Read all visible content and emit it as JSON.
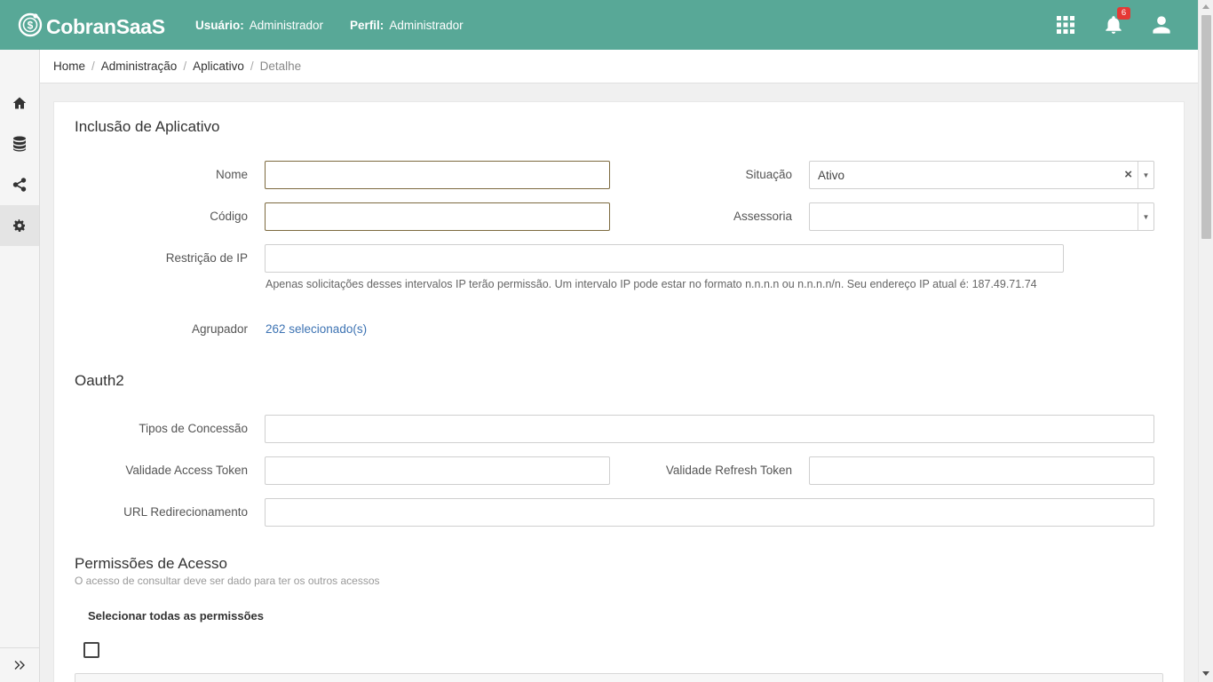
{
  "app": {
    "brand": "CobranSaaS",
    "accent": "#58a897"
  },
  "header": {
    "user_label": "Usuário:",
    "user_value": "Administrador",
    "profile_label": "Perfil:",
    "profile_value": "Administrador",
    "notification_count": "6",
    "icons": [
      "apps-grid-icon",
      "bell-icon",
      "user-icon"
    ]
  },
  "sidebar": {
    "items": [
      "home-icon",
      "database-icon",
      "share-icon",
      "gear-icon"
    ],
    "expand_icon": "double-chevron-right-icon"
  },
  "breadcrumb": {
    "home": "Home",
    "admin": "Administração",
    "app": "Aplicativo",
    "current": "Detalhe"
  },
  "form": {
    "title": "Inclusão de Aplicativo",
    "nome_label": "Nome",
    "nome_value": "",
    "situacao_label": "Situação",
    "situacao_value": "Ativo",
    "codigo_label": "Código",
    "codigo_value": "",
    "assessoria_label": "Assessoria",
    "assessoria_value": "",
    "restricao_label": "Restrição de IP",
    "restricao_value": "",
    "restricao_help": "Apenas solicitações desses intervalos IP terão permissão. Um intervalo IP pode estar no formato n.n.n.n ou n.n.n.n/n. Seu endereço IP atual é: 187.49.71.74",
    "agrupador_label": "Agrupador",
    "agrupador_value": "262 selecionado(s)"
  },
  "oauth": {
    "title": "Oauth2",
    "tipos_label": "Tipos de Concessão",
    "tipos_value": "",
    "access_label": "Validade Access Token",
    "access_value": "",
    "refresh_label": "Validade Refresh Token",
    "refresh_value": "",
    "url_label": "URL Redirecionamento",
    "url_value": ""
  },
  "permissions": {
    "title": "Permissões de Acesso",
    "subtitle": "O acesso de consultar deve ser dado para ter os outros acessos",
    "select_all_label": "Selecionar todas as permissões",
    "select_all_checked": false
  }
}
